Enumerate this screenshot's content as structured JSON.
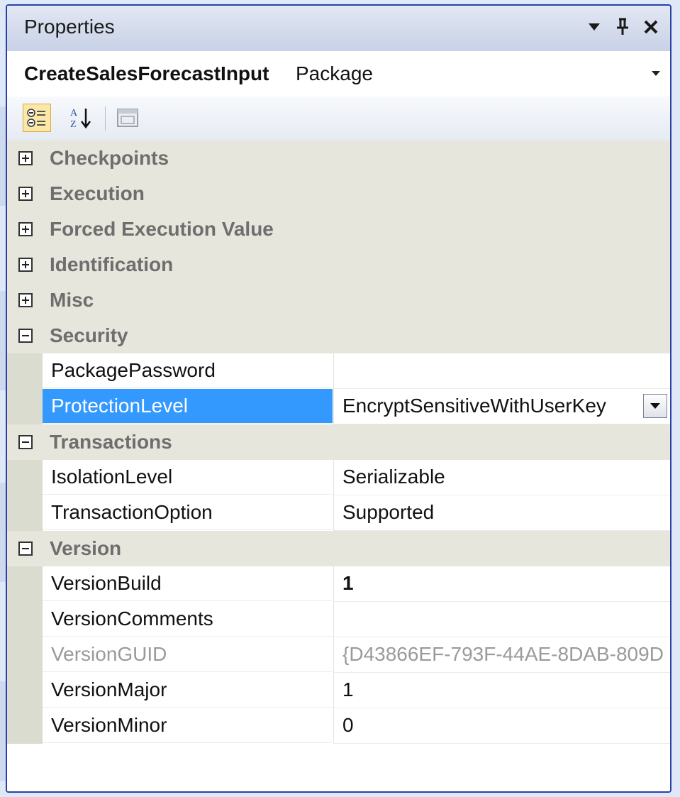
{
  "window": {
    "title": "Properties",
    "buttons": {
      "dropdown": "▾",
      "pin": "ᵩ",
      "close": "✕"
    }
  },
  "object_selector": {
    "name": "CreateSalesForecastInput",
    "type": "Package"
  },
  "toolbar": {
    "icons": [
      "categorized-icon",
      "alphabetical-icon",
      "property-pages-icon"
    ]
  },
  "grid": {
    "categories_collapsed": [
      "Checkpoints",
      "Execution",
      "Forced Execution Value",
      "Identification",
      "Misc"
    ],
    "security": {
      "label": "Security",
      "rows": [
        {
          "name": "PackagePassword",
          "value": ""
        },
        {
          "name": "ProtectionLevel",
          "value": "EncryptSensitiveWithUserKey",
          "selected": true
        }
      ]
    },
    "transactions": {
      "label": "Transactions",
      "rows": [
        {
          "name": "IsolationLevel",
          "value": "Serializable"
        },
        {
          "name": "TransactionOption",
          "value": "Supported"
        }
      ]
    },
    "version": {
      "label": "Version",
      "rows": [
        {
          "name": "VersionBuild",
          "value": "1"
        },
        {
          "name": "VersionComments",
          "value": ""
        },
        {
          "name": "VersionGUID",
          "value": "{D43866EF-793F-44AE-8DAB-809D",
          "readonly": true
        },
        {
          "name": "VersionMajor",
          "value": "1"
        },
        {
          "name": "VersionMinor",
          "value": "0"
        }
      ]
    }
  },
  "colors": {
    "frame": "#2b3fa6",
    "selection": "#3399ff",
    "category_bg": "#e6e6dc"
  }
}
